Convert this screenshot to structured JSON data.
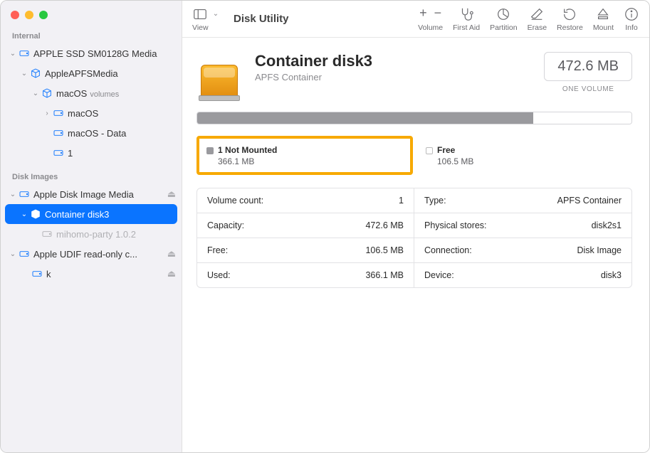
{
  "app_title": "Disk Utility",
  "toolbar": {
    "view": "View",
    "volume": "Volume",
    "first_aid": "First Aid",
    "partition": "Partition",
    "erase": "Erase",
    "restore": "Restore",
    "mount": "Mount",
    "info": "Info"
  },
  "sidebar": {
    "section_internal": "Internal",
    "section_diskimages": "Disk Images",
    "internal": [
      {
        "label": "APPLE SSD SM0128G Media"
      },
      {
        "label": "AppleAPFSMedia"
      },
      {
        "label": "macOS",
        "sub": "volumes"
      },
      {
        "label": "macOS"
      },
      {
        "label": "macOS - Data"
      },
      {
        "label": "1"
      }
    ],
    "images": [
      {
        "label": "Apple Disk Image Media"
      },
      {
        "label": "Container disk3"
      },
      {
        "label": "mihomo-party 1.0.2"
      },
      {
        "label": "Apple UDIF read-only c..."
      },
      {
        "label": "k"
      }
    ]
  },
  "header": {
    "title": "Container disk3",
    "subtitle": "APFS Container",
    "size": "472.6 MB",
    "volumes_caption": "ONE VOLUME"
  },
  "usage": {
    "used_pct": 77.4
  },
  "legend": {
    "used_title": "1 Not Mounted",
    "used_value": "366.1 MB",
    "free_title": "Free",
    "free_value": "106.5 MB"
  },
  "info": {
    "left": [
      {
        "k": "Volume count:",
        "v": "1"
      },
      {
        "k": "Capacity:",
        "v": "472.6 MB"
      },
      {
        "k": "Free:",
        "v": "106.5 MB"
      },
      {
        "k": "Used:",
        "v": "366.1 MB"
      }
    ],
    "right": [
      {
        "k": "Type:",
        "v": "APFS Container"
      },
      {
        "k": "Physical stores:",
        "v": "disk2s1"
      },
      {
        "k": "Connection:",
        "v": "Disk Image"
      },
      {
        "k": "Device:",
        "v": "disk3"
      }
    ]
  }
}
